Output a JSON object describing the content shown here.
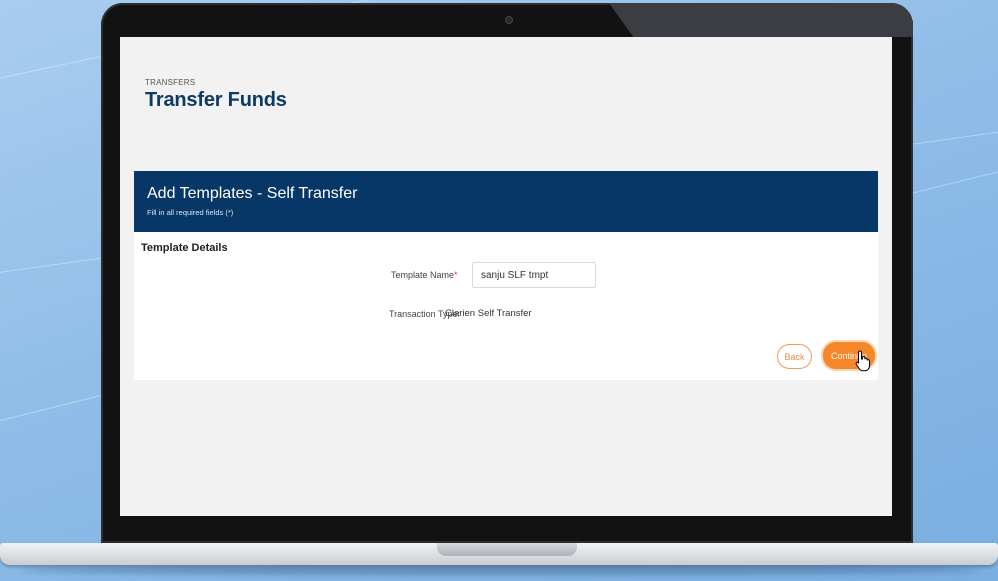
{
  "page": {
    "overline": "TRANSFERS",
    "title": "Transfer Funds"
  },
  "panel": {
    "title": "Add Templates - Self Transfer",
    "subtitle": "Fill in all required fields (*)"
  },
  "form": {
    "section_title": "Template Details",
    "template_name_label": "Template Name",
    "required_marker": "*",
    "template_name_value": "sanju SLF tmpt",
    "transaction_type_label": "Transaction Type:",
    "transaction_type_value": "Clarien Self Transfer"
  },
  "actions": {
    "back_label": "Back",
    "continue_label": "Continue"
  },
  "colors": {
    "header_bg": "#063766",
    "accent": "#f5862a",
    "title": "#0e3a63"
  }
}
